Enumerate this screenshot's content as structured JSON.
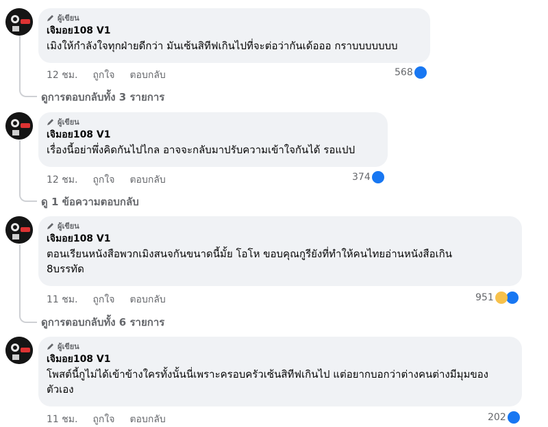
{
  "comments": [
    {
      "badge": "ผู้เขียน",
      "author": "เจิมอย108 V1",
      "text": "เมิงให้กำลังใจทุกฝ่ายดีกว่า มันเซ้นสิทีฟเกินไปที่จะต่อว่ากันเด้อออ กราบบบบบบบ",
      "time": "12 ชม.",
      "like": "ถูกใจ",
      "reply": "ตอบกลับ",
      "reaction_count": "568",
      "reactions": [
        "like-icon"
      ],
      "view_replies": "ดูการตอบกลับทั้ง 3 รายการ"
    },
    {
      "badge": "ผู้เขียน",
      "author": "เจิมอย108 V1",
      "text": "เรื่องนี้อย่าพึ่งคิดกันไปไกล อาจจะกลับมาปรับความเข้าใจกันได้ รอแปป",
      "time": "12 ชม.",
      "like": "ถูกใจ",
      "reply": "ตอบกลับ",
      "reaction_count": "374",
      "reactions": [
        "like-icon"
      ],
      "view_replies": "ดู 1 ข้อความตอบกลับ"
    },
    {
      "badge": "ผู้เขียน",
      "author": "เจิมอย108 V1",
      "text_line1": "ตอนเรียนหนังสือพวกเมิงสนจกันขนาดนี้มั้ย โอโห ขอบคุณกูรียังที่ทำให้คนไทยอ่านหนังสือเกิน",
      "text_line2": "8บรรทัด",
      "time": "11 ชม.",
      "like": "ถูกใจ",
      "reply": "ตอบกลับ",
      "reaction_count": "951",
      "reactions": [
        "haha-icon",
        "like-icon"
      ],
      "view_replies": "ดูการตอบกลับทั้ง 6 รายการ"
    },
    {
      "badge": "ผู้เขียน",
      "author": "เจิมอย108 V1",
      "text_line1": "โพสต์นี้กูไม่ได้เข้าข้างใครทั้งนั้นนี่เพราะครอบครัวเซ้นสิทีฟเกินไป แต่อยากบอกว่าต่างคนต่างมีมุมของ",
      "text_line2": "ตัวเอง",
      "time": "11 ชม.",
      "like": "ถูกใจ",
      "reply": "ตอบกลับ",
      "reaction_count": "202",
      "reactions": [
        "like-icon"
      ]
    }
  ],
  "colors": {
    "bubble": "#f0f2f5",
    "secondary_text": "#65676b",
    "like_blue": "#1877f2"
  }
}
